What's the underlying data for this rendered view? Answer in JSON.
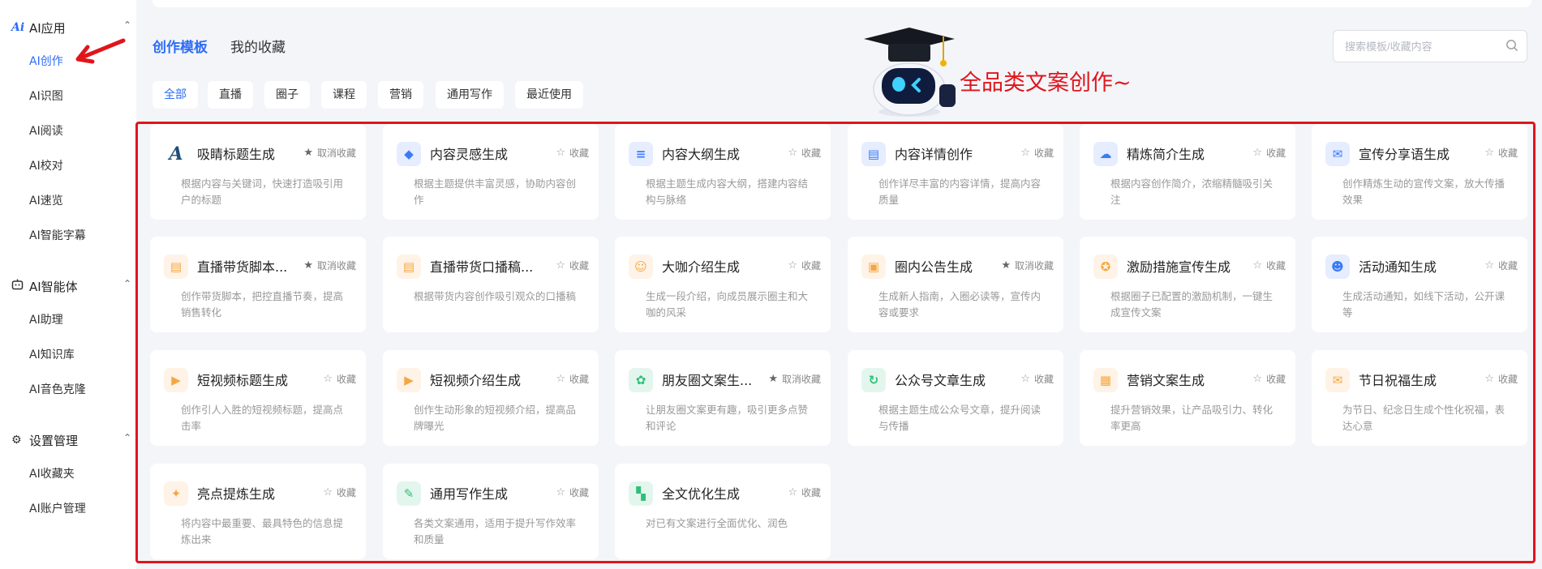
{
  "sidebar": {
    "groups": [
      {
        "label": "AI应用",
        "icon": "ai-logo-icon",
        "items": [
          "AI创作",
          "AI识图",
          "AI阅读",
          "AI校对",
          "AI速览",
          "AI智能字幕"
        ]
      },
      {
        "label": "AI智能体",
        "icon": "robot-icon",
        "items": [
          "AI助理",
          "AI知识库",
          "AI音色克隆"
        ]
      },
      {
        "label": "设置管理",
        "icon": "gear-icon",
        "items": [
          "AI收藏夹",
          "AI账户管理"
        ]
      }
    ],
    "active_item": "AI创作"
  },
  "header": {
    "tabs": [
      "创作模板",
      "我的收藏"
    ],
    "active_tab": "创作模板",
    "search_placeholder": "搜索模板/收藏内容"
  },
  "filters": [
    "全部",
    "直播",
    "圈子",
    "课程",
    "营销",
    "通用写作",
    "最近使用"
  ],
  "active_filter": "全部",
  "annotation": {
    "headline": "全品类文案创作~",
    "color": "#e0151c"
  },
  "colors": {
    "accent": "#2d6cf6",
    "annotation_red": "#e0151c"
  },
  "cards": [
    {
      "title": "吸睛标题生成",
      "desc": "根据内容与关键词，快速打造吸引用户的标题",
      "fav": "取消收藏",
      "icon": "calligraphy-icon",
      "color": "#1f4e79"
    },
    {
      "title": "内容灵感生成",
      "desc": "根据主题提供丰富灵感，协助内容创作",
      "fav": "收藏",
      "icon": "shield-icon",
      "color": "#3a7bf5"
    },
    {
      "title": "内容大纲生成",
      "desc": "根据主题生成内容大纲，搭建内容结构与脉络",
      "fav": "收藏",
      "icon": "list-icon",
      "color": "#3a7bf5"
    },
    {
      "title": "内容详情创作",
      "desc": "创作详尽丰富的内容详情，提高内容质量",
      "fav": "收藏",
      "icon": "document-icon",
      "color": "#3a7bf5"
    },
    {
      "title": "精炼简介生成",
      "desc": "根据内容创作简介，浓缩精髓吸引关注",
      "fav": "收藏",
      "icon": "cloud-icon",
      "color": "#3a7bf5"
    },
    {
      "title": "宣传分享语生成",
      "desc": "创作精炼生动的宣传文案，放大传播效果",
      "fav": "收藏",
      "icon": "megaphone-icon",
      "color": "#3a7bf5"
    },
    {
      "title": "直播带货脚本...",
      "desc": "创作带货脚本，把控直播节奏，提高销售转化",
      "fav": "取消收藏",
      "icon": "script-icon",
      "color": "#f5a742"
    },
    {
      "title": "直播带货口播稿...",
      "desc": "根据带货内容创作吸引观众的口播稿",
      "fav": "收藏",
      "icon": "script-icon",
      "color": "#f5a742"
    },
    {
      "title": "大咖介绍生成",
      "desc": "生成一段介绍，向成员展示圈主和大咖的风采",
      "fav": "收藏",
      "icon": "person-icon",
      "color": "#f5a742"
    },
    {
      "title": "圈内公告生成",
      "desc": "生成新人指南，入圈必读等，宣传内容或要求",
      "fav": "取消收藏",
      "icon": "notice-icon",
      "color": "#f5a742"
    },
    {
      "title": "激励措施宣传生成",
      "desc": "根据圈子已配置的激励机制，一键生成宣传文案",
      "fav": "收藏",
      "icon": "award-icon",
      "color": "#f5a742"
    },
    {
      "title": "活动通知生成",
      "desc": "生成活动通知，如线下活动，公开课等",
      "fav": "收藏",
      "icon": "people-icon",
      "color": "#3a7bf5"
    },
    {
      "title": "短视频标题生成",
      "desc": "创作引人入胜的短视频标题，提高点击率",
      "fav": "收藏",
      "icon": "video-icon",
      "color": "#f5a742"
    },
    {
      "title": "短视频介绍生成",
      "desc": "创作生动形象的短视频介绍，提高品牌曝光",
      "fav": "收藏",
      "icon": "video-icon",
      "color": "#f5a742"
    },
    {
      "title": "朋友圈文案生...",
      "desc": "让朋友圈文案更有趣，吸引更多点赞和评论",
      "fav": "取消收藏",
      "icon": "aperture-icon",
      "color": "#2fbf7a"
    },
    {
      "title": "公众号文章生成",
      "desc": "根据主题生成公众号文章，提升阅读与传播",
      "fav": "收藏",
      "icon": "refresh-icon",
      "color": "#2fbf7a"
    },
    {
      "title": "营销文案生成",
      "desc": "提升营销效果，让产品吸引力、转化率更高",
      "fav": "收藏",
      "icon": "shop-icon",
      "color": "#f5a742"
    },
    {
      "title": "节日祝福生成",
      "desc": "为节日、纪念日生成个性化祝福，表达心意",
      "fav": "收藏",
      "icon": "envelope-icon",
      "color": "#f5a742"
    },
    {
      "title": "亮点提炼生成",
      "desc": "将内容中最重要、最具特色的信息提炼出来",
      "fav": "收藏",
      "icon": "sparkle-icon",
      "color": "#f5a742"
    },
    {
      "title": "通用写作生成",
      "desc": "各类文案通用，适用于提升写作效率和质量",
      "fav": "收藏",
      "icon": "pen-icon",
      "color": "#2fbf7a"
    },
    {
      "title": "全文优化生成",
      "desc": "对已有文案进行全面优化、润色",
      "fav": "收藏",
      "icon": "optimize-icon",
      "color": "#2fbf7a"
    }
  ]
}
